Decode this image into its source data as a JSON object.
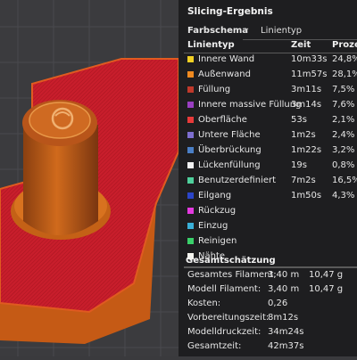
{
  "panel": {
    "title": "Slicing-Ergebnis",
    "scheme_label": "Farbschema",
    "scheme_value": "Linientyp",
    "headers": {
      "type": "Linientyp",
      "time": "Zeit",
      "percent": "Prozen"
    }
  },
  "features": [
    {
      "label": "Innere Wand",
      "time": "10m33s",
      "pct": "24,8%",
      "color": "#f2d024"
    },
    {
      "label": "Außenwand",
      "time": "11m57s",
      "pct": "28,1%",
      "color": "#f08a20"
    },
    {
      "label": "Füllung",
      "time": "3m11s",
      "pct": "7,5%",
      "color": "#c0392b"
    },
    {
      "label": "Innere massive Füllung",
      "time": "3m14s",
      "pct": "7,6%",
      "color": "#9a3fc2"
    },
    {
      "label": "Oberfläche",
      "time": "53s",
      "pct": "2,1%",
      "color": "#e83a3a"
    },
    {
      "label": "Untere Fläche",
      "time": "1m2s",
      "pct": "2,4%",
      "color": "#7e6fd0"
    },
    {
      "label": "Überbrückung",
      "time": "1m22s",
      "pct": "3,2%",
      "color": "#4a7fc6"
    },
    {
      "label": "Lückenfüllung",
      "time": "19s",
      "pct": "0,8%",
      "color": "#f2f2f2"
    },
    {
      "label": "Benutzerdefiniert",
      "time": "7m2s",
      "pct": "16,5%",
      "color": "#4fd09c"
    },
    {
      "label": "Eilgang",
      "time": "1m50s",
      "pct": "4,3%",
      "color": "#2b45c8"
    },
    {
      "label": "Rückzug",
      "time": "",
      "pct": "",
      "color": "#e43ae0"
    },
    {
      "label": "Einzug",
      "time": "",
      "pct": "",
      "color": "#3ab0d8"
    },
    {
      "label": "Reinigen",
      "time": "",
      "pct": "",
      "color": "#3ad06a"
    },
    {
      "label": "Nähte",
      "time": "",
      "pct": "",
      "color": "#f7f7f0"
    }
  ],
  "estimate": {
    "title": "Gesamtschätzung",
    "rows": [
      {
        "label": "Gesamtes Filament:",
        "v1": "3,40 m",
        "v2": "10,47 g"
      },
      {
        "label": "Modell Filament:",
        "v1": "3,40 m",
        "v2": "10,47 g"
      },
      {
        "label": "Kosten:",
        "v1": "0,26",
        "v2": ""
      },
      {
        "label": "Vorbereitungszeit:",
        "v1": "8m12s",
        "v2": ""
      },
      {
        "label": "Modelldruckzeit:",
        "v1": "34m24s",
        "v2": ""
      },
      {
        "label": "Gesamtzeit:",
        "v1": "42m37s",
        "v2": ""
      }
    ]
  }
}
